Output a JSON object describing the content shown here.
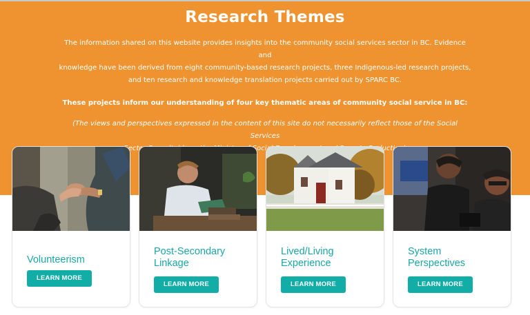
{
  "hero": {
    "title": "Research Themes",
    "intro_line1": "The information shared on this website provides insights into the community social services sector in BC.  Evidence and",
    "intro_line2": "knowledge have been derived from eight community-based research projects, three Indigenous-led research projects,",
    "intro_line3": "and ten research and knowledge translation projects carried out by SPARC BC.",
    "subintro": "These projects inform our understanding of four key thematic areas of community social service in BC:",
    "disclaimer_line1": "(The views and perspectives expressed in the content of this site do not necessarily reflect those of the Social Services",
    "disclaimer_line2": "Sector Roundtable or the Ministry of Social Development and Poverty Reduction)"
  },
  "cards": [
    {
      "title_line1": "Volunteerism",
      "title_line2": "",
      "button": "LEARN MORE"
    },
    {
      "title_line1": "Post-Secondary",
      "title_line2": "Linkage",
      "button": "LEARN MORE"
    },
    {
      "title_line1": "Lived/Living",
      "title_line2": "Experience",
      "button": "LEARN MORE"
    },
    {
      "title_line1": "System",
      "title_line2": "Perspectives",
      "button": "LEARN MORE"
    }
  ],
  "colors": {
    "hero_bg": "#EE9330",
    "accent_teal": "#11ADA6",
    "card_title": "#1aa7a6"
  }
}
